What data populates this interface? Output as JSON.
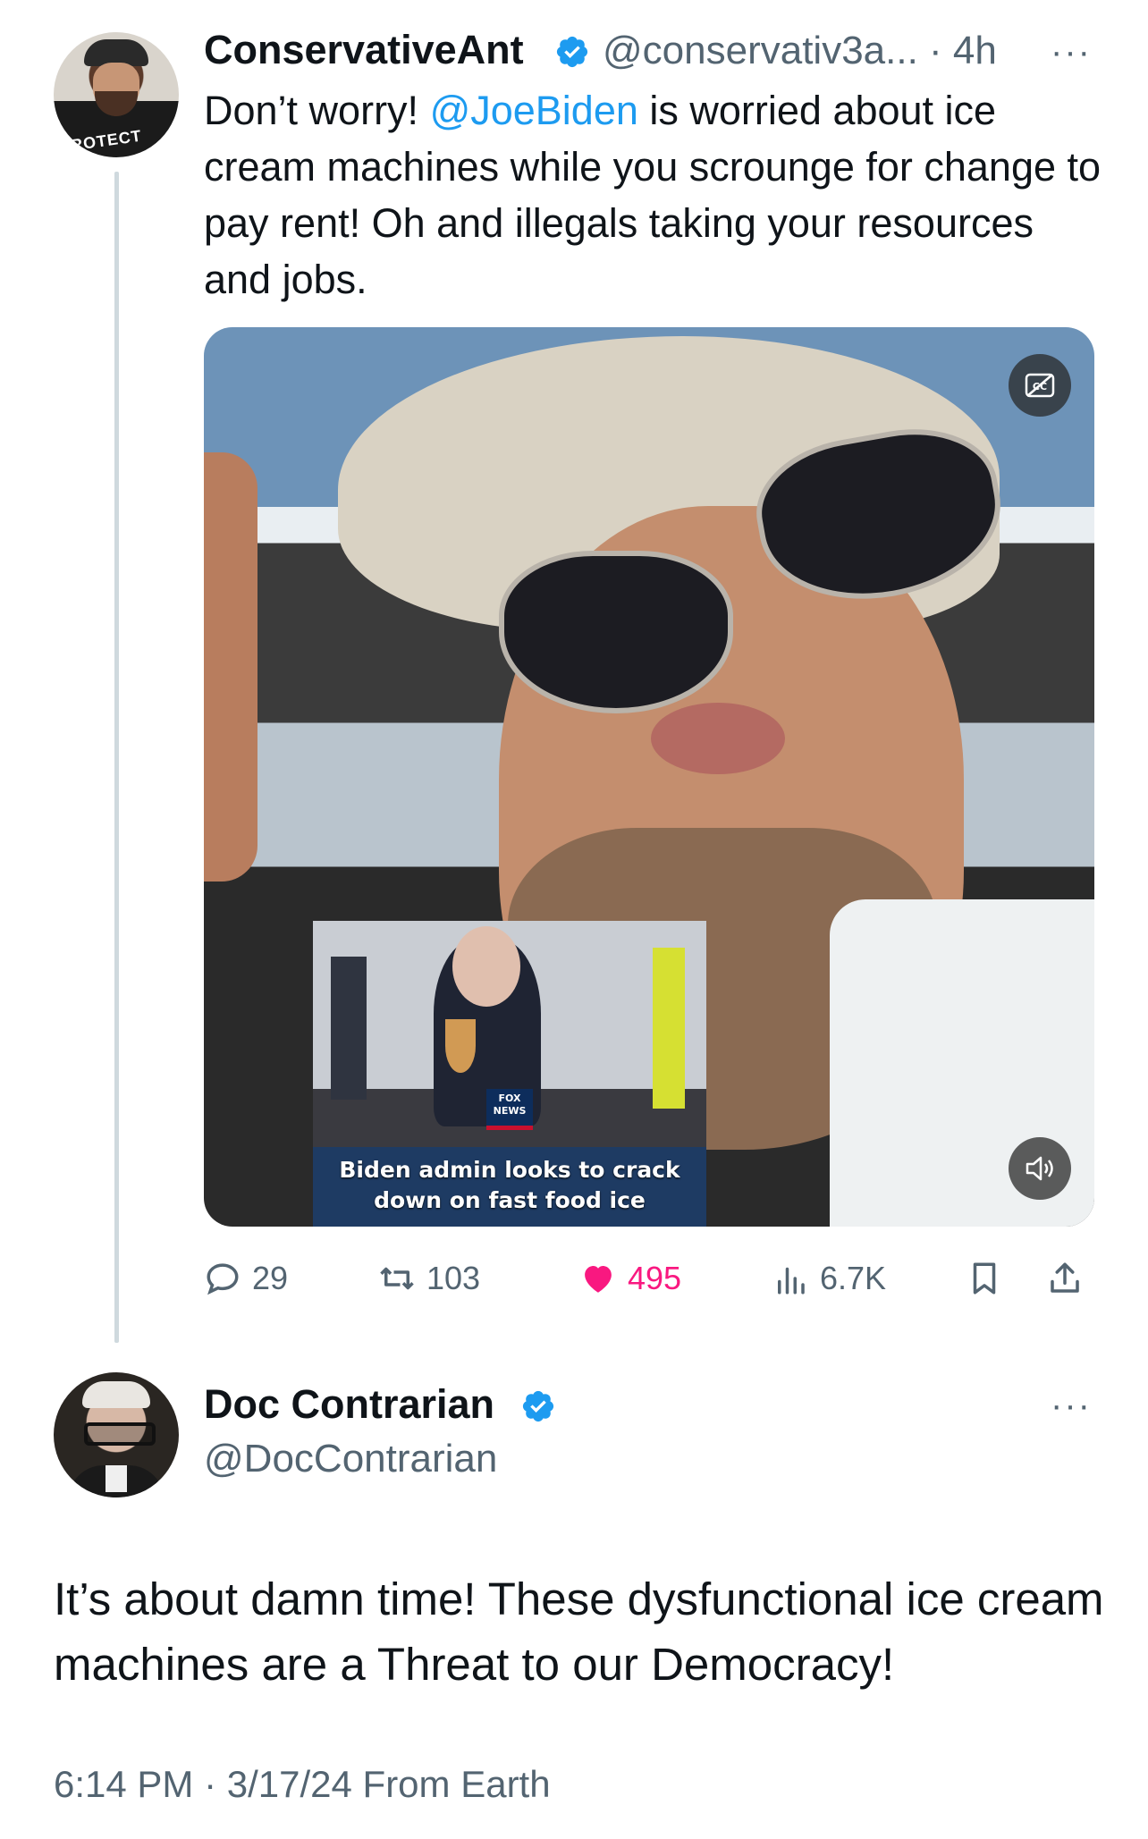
{
  "colors": {
    "text": "#0f1419",
    "secondary": "#536471",
    "link": "#1d9bf0",
    "like": "#f91880",
    "verified": "#1d9bf0"
  },
  "parent_tweet": {
    "author_name": "ConservativeAnt",
    "handle_time": "@conservativ3a... · 4h",
    "more_label": "···",
    "text_before": "Don’t worry! ",
    "mention": "@JoeBiden",
    "text_after": " is worried about ice cream machines while you scrounge for change to pay rent! Oh and illegals taking your resources and jobs.",
    "avatar_shirt_text": "PROTECT",
    "media": {
      "type": "video",
      "cc_icon": "closed-captions-off-icon",
      "volume_icon": "volume-icon",
      "inset_logo": "FOX NEWS",
      "inset_caption": "Biden admin looks to crack down on fast food ice"
    },
    "actions": {
      "replies": "29",
      "reposts": "103",
      "likes": "495",
      "views": "6.7K"
    }
  },
  "focused_tweet": {
    "author_name": "Doc Contrarian",
    "handle": "@DocContrarian",
    "more_label": "···",
    "text": "It’s about damn time! These dysfunctional ice cream machines are a Threat to our Democracy!",
    "timestamp": "6:14 PM · 3/17/24 From Earth"
  }
}
